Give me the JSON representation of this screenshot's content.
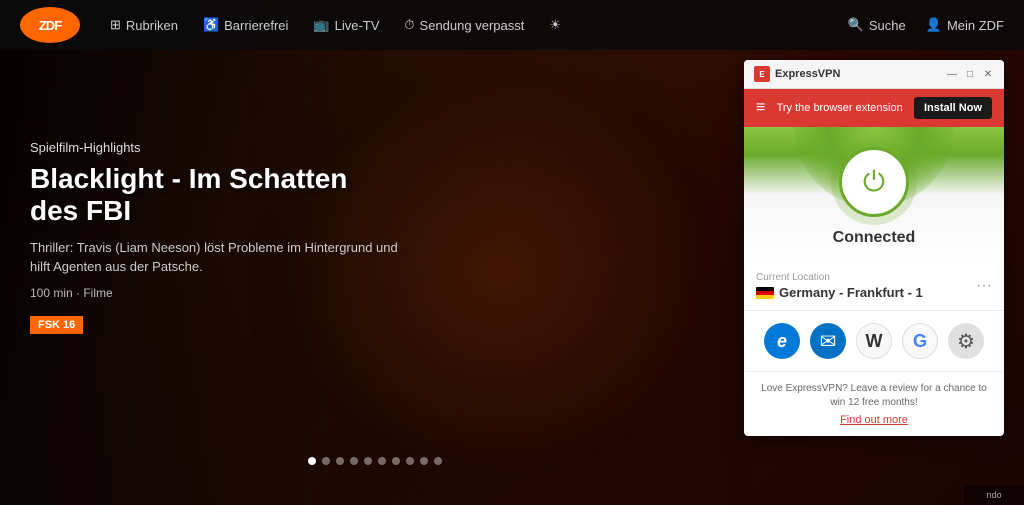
{
  "zdf": {
    "logo": "ZDF",
    "nav": {
      "rubriken": "Rubriken",
      "barrierefrei": "Barrierefrei",
      "livetv": "Live-TV",
      "sendung_verpasst": "Sendung verpasst",
      "suche": "Suche",
      "mein_zdf": "Mein ZDF"
    },
    "movie": {
      "category": "Spielfilm-Highlights",
      "title_line1": "Blacklight - Im Schatten",
      "title_line2": "des FBI",
      "description": "Thriller: Travis (Liam Neeson) löst Probleme im Hintergrund und hilft Agenten aus der Patsche.",
      "meta": "100 min · Filme",
      "fsk": "FSK 16"
    },
    "dots": [
      "active",
      "",
      "",
      "",
      "",
      "",
      "",
      "",
      "",
      ""
    ]
  },
  "vpn": {
    "title": "ExpressVPN",
    "window_controls": {
      "minimize": "—",
      "maximize": "□",
      "close": "✕"
    },
    "toolbar": {
      "menu_icon": "≡",
      "browser_ext": "Try the browser extension",
      "install_btn": "Install Now"
    },
    "power_icon": "⏻",
    "status": "Connected",
    "location": {
      "label": "Current Location",
      "country": "Germany - Frankfurt - 1"
    },
    "shortcuts": [
      {
        "name": "edge",
        "label": "e"
      },
      {
        "name": "mail",
        "label": "✉"
      },
      {
        "name": "wikipedia",
        "label": "W"
      },
      {
        "name": "google",
        "label": "G"
      },
      {
        "name": "settings",
        "label": "⚙"
      }
    ],
    "promo": {
      "text": "Love ExpressVPN? Leave a review for a chance to win 12 free months!",
      "link": "Find out more"
    }
  }
}
